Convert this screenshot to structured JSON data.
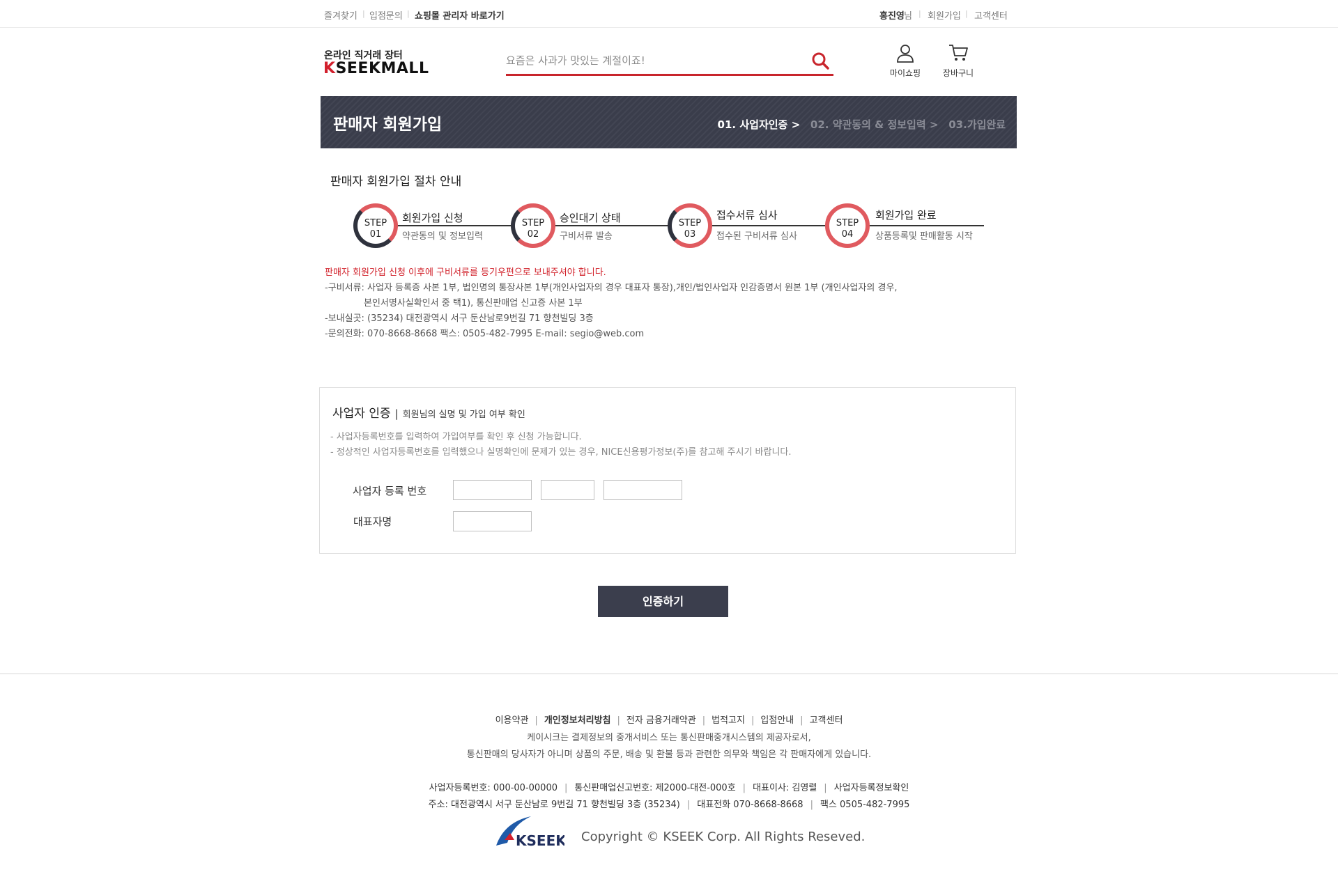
{
  "topbar": {
    "left_links": [
      "즐겨찾기",
      "입점문의",
      "쇼핑몰 관리자 바로가기"
    ],
    "user_name": "홍진영",
    "user_suffix": "님",
    "right_links": [
      "회원가입",
      "고객센터"
    ]
  },
  "header": {
    "logo_tagline": "온라인 직거래 장터",
    "logo_k": "K",
    "logo_rest": "SEEKMALL",
    "search_placeholder": "요즘은 사과가 맛있는 계절이죠!",
    "myshop_label": "마이쇼핑",
    "cart_label": "장바구니"
  },
  "banner": {
    "title": "판매자 회원가입",
    "step1": "01. 사업자인증 >",
    "step2": "02. 약관동의 & 정보입력 >",
    "step3": "03.가입완료"
  },
  "guide": {
    "title": "판매자 회원가입 절차 안내",
    "steps": [
      {
        "label": "STEP",
        "num": "01",
        "name": "회원가입 신청",
        "desc": "약관동의 및 정보입력"
      },
      {
        "label": "STEP",
        "num": "02",
        "name": "승인대기 상태",
        "desc": "구비서류 발송"
      },
      {
        "label": "STEP",
        "num": "03",
        "name": "접수서류 심사",
        "desc": "접수된 구비서류 심사"
      },
      {
        "label": "STEP",
        "num": "04",
        "name": "회원가입 완료",
        "desc": "상품등록및 판매활동 시작"
      }
    ]
  },
  "notice": {
    "red": "판매자 회원가입 신청 이후에 구비서류를 등기우편으로 보내주셔야 합니다.",
    "line1": "-구비서류: 사업자 등록증 사본 1부, 법인명의 통장사본 1부(개인사업자의 경우 대표자 통장),개인/법인사업자 인감증명서 원본 1부 (개인사업자의 경우,",
    "line2": "본인서명사실확인서 중 택1), 통신판매업 신고증 사본 1부",
    "line3": "-보내실곳: (35234) 대전광역시 서구 둔산남로9번길 71 향천빌딩 3층",
    "line4": "-문의전화: 070-8668-8668  팩스: 0505-482-7995    E-mail: segio@web.com"
  },
  "form": {
    "title": "사업자 인증",
    "bar": "|",
    "subtitle": "회원님의 실명 및 가입 여부 확인",
    "note1": "- 사업자등록번호를 입력하여 가입여부를 확인 후 신청 가능합니다.",
    "note2": "- 정상적인 사업자등록번호를 입력했으나 실명확인에 문제가 있는 경우, NICE신용평가정보(주)를 참고해 주시기 바랍니다.",
    "bizno_label": "사업자 등록 번호",
    "ceo_label": "대표자명",
    "submit": "인증하기"
  },
  "footer": {
    "links": [
      "이용약관",
      "개인정보처리방침",
      "전자 금융거래약관",
      "법적고지",
      "입점안내",
      "고객센터"
    ],
    "desc1": "케이시크는 결제정보의 중개서비스 또는 통신판매중개시스템의 제공자로서,",
    "desc2": "통신판매의 당사자가 아니며 상품의 주문, 배송 및 환불 등과 관련한 의무와 책임은 각 판매자에게 있습니다.",
    "info1": [
      "사업자등록번호: 000-00-00000",
      "통신판매업신고번호:  제2000-대전-000호",
      "대표이사: 김영렬",
      "사업자등록정보확인"
    ],
    "info2": [
      "주소: 대전광역시 서구 둔산남로 9번길 71  향천빌딩 3층  (35234)",
      "대표전화 070-8668-8668",
      "팩스  0505-482-7995"
    ],
    "logo_text": "KSEEK",
    "copyright": "Copyright © KSEEK  Corp. All Rights Reseved."
  }
}
